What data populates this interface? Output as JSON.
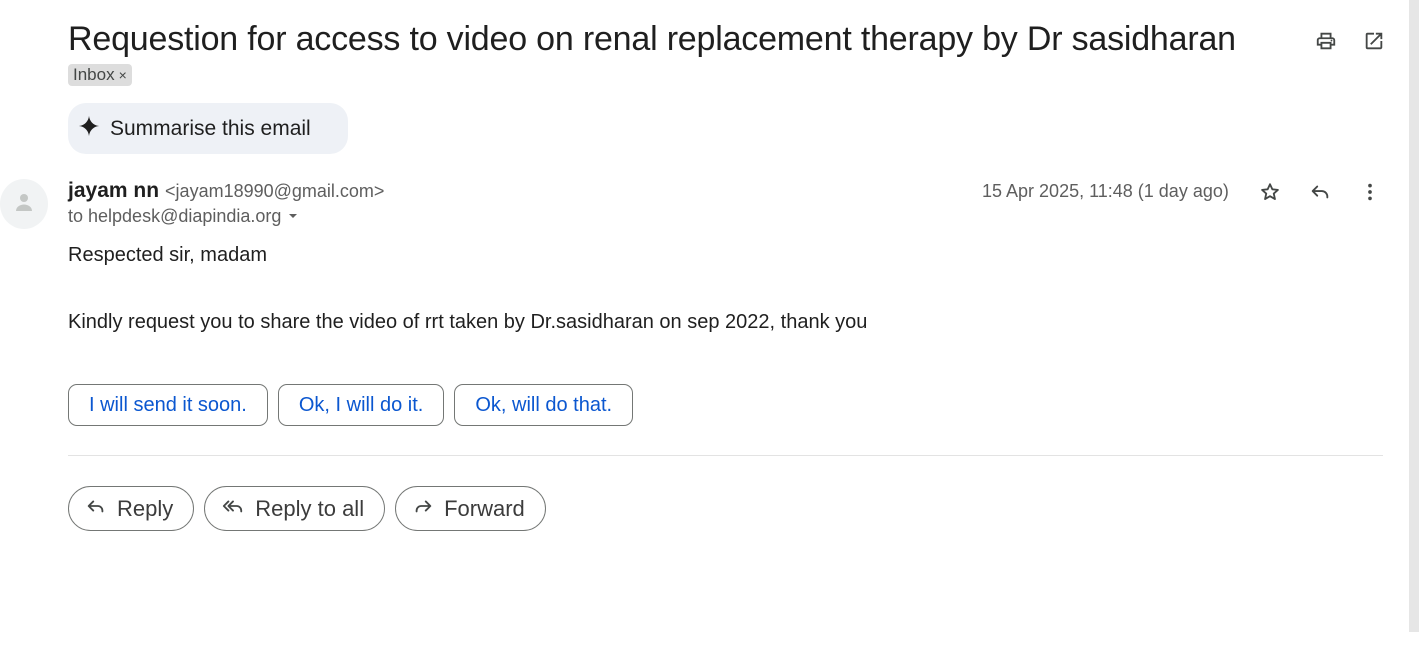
{
  "email": {
    "subject": "Requestion for access to video on renal replacement therapy by Dr sasidharan",
    "label_chip": "Inbox",
    "label_remove": "×",
    "summarise_label": "Summarise this email",
    "sender_name": "jayam nn",
    "sender_email": "<jayam18990@gmail.com>",
    "to_line": "to helpdesk@diapindia.org",
    "date": "15 Apr 2025, 11:48 (1 day ago)",
    "greeting": "Respected sir, madam",
    "body": "Kindly request you to share the video of rrt taken by Dr.sasidharan on sep 2022, thank you"
  },
  "smart_replies": [
    "I will send it soon.",
    "Ok, I will do it.",
    "Ok, will do that."
  ],
  "actions": {
    "reply": "Reply",
    "reply_all": "Reply to all",
    "forward": "Forward"
  },
  "icons": {
    "print": "print-icon",
    "open_new_window": "open-in-new-icon",
    "star": "star-icon",
    "reply": "reply-icon",
    "more": "more-vert-icon",
    "sparkle": "sparkle-icon",
    "avatar": "person-icon",
    "dropdown": "caret-down-icon"
  },
  "colors": {
    "link_blue": "#0b57d0",
    "summarise_bg": "#eef1f6",
    "chip_bg": "#dddddd"
  }
}
